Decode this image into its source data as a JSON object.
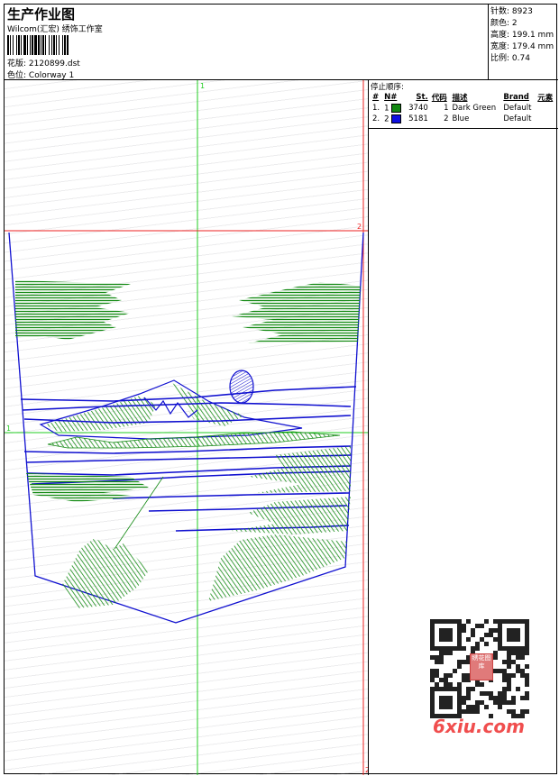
{
  "header": {
    "title": "生产作业图",
    "studio": "Wilcom(汇宏) 绣饰工作室",
    "design_file_label": "花版:",
    "design_file": "2120899.dst",
    "colorway_label": "色位:",
    "colorway": "Colorway 1"
  },
  "stats": {
    "stitches_label": "针数:",
    "stitches": "8923",
    "colors_label": "颜色:",
    "colors": "2",
    "height_label": "高度:",
    "height": "199.1 mm",
    "width_label": "宽度:",
    "width": "179.4 mm",
    "scale_label": "比例:",
    "scale": "0.74"
  },
  "stop_sequence": {
    "title": "停止顺序:",
    "columns": [
      "#",
      "N#",
      "St.",
      "代码",
      "描述",
      "Brand",
      "元素"
    ],
    "rows": [
      {
        "index": "1.",
        "n": "1",
        "color": "#148a14",
        "st": "3740",
        "code": "1",
        "desc": "Dark Green",
        "brand": "Default"
      },
      {
        "index": "2.",
        "n": "2",
        "color": "#1010e0",
        "st": "5181",
        "code": "2",
        "desc": "Blue",
        "brand": "Default"
      }
    ]
  },
  "design": {
    "crosshair_color": "#22cc22",
    "guide_color": "#ee2222",
    "thread_green": "#148a14",
    "thread_blue": "#1010d0",
    "marker_top": "1",
    "marker_left": "1",
    "marker_right": "2",
    "marker_bottom": "2"
  },
  "watermark": {
    "badge": "绣花图库",
    "logo": "6xiu.com"
  }
}
